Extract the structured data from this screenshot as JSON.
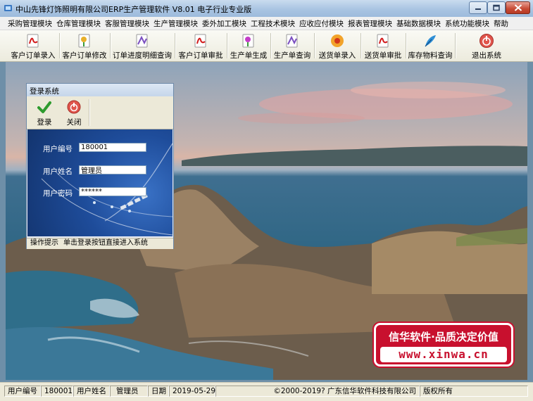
{
  "window": {
    "title": "中山先锋灯饰照明有限公司ERP生产管理软件  V8.01 电子行业专业版"
  },
  "menu": [
    "采购管理模块",
    "仓库管理模块",
    "客服管理模块",
    "生产管理模块",
    "委外加工模块",
    "工程技术模块",
    "应收应付模块",
    "报表管理模块",
    "基础数据模块",
    "系统功能模块",
    "帮助"
  ],
  "toolbar": [
    {
      "label": "客户订单录入",
      "icon": "pdf-icon"
    },
    {
      "label": "客户订单修改",
      "icon": "flower-icon"
    },
    {
      "label": "订单进度明细查询",
      "icon": "document-icon"
    },
    {
      "label": "客户订单审批",
      "icon": "pdf-icon"
    },
    {
      "label": "生产单生成",
      "icon": "flower-icon"
    },
    {
      "label": "生产单查询",
      "icon": "document-icon"
    },
    {
      "label": "送货单录入",
      "icon": "sun-flower-icon"
    },
    {
      "label": "送货单审批",
      "icon": "pdf-icon"
    },
    {
      "label": "库存物料查询",
      "icon": "feather-icon"
    },
    {
      "label": "退出系统",
      "icon": "exit-icon"
    }
  ],
  "login": {
    "title": "登录系统",
    "login_button": "登录",
    "close_button": "关闭",
    "user_id_label": "用户编号",
    "user_id_value": "180001",
    "user_name_label": "用户姓名",
    "user_name_value": "管理员",
    "password_label": "用户密码",
    "password_value": "******",
    "status_label": "操作提示",
    "status_text": "单击登录按钮直接进入系统"
  },
  "promo": {
    "line1": "信华软件·品质决定价值",
    "line2": "www.xinwa.cn"
  },
  "statusbar": {
    "user_id_label": "用户编号",
    "user_id": "180001",
    "user_name_label": "用户姓名",
    "user_name": "管理员",
    "date_label": "日期",
    "date": "2019-05-29",
    "copyright": "©2000-2019?  广东信华软件科技有限公司",
    "rights": "版权所有"
  },
  "colors": {
    "promo_red": "#c8102e",
    "login_panel_blue": "#1e4c9a"
  }
}
